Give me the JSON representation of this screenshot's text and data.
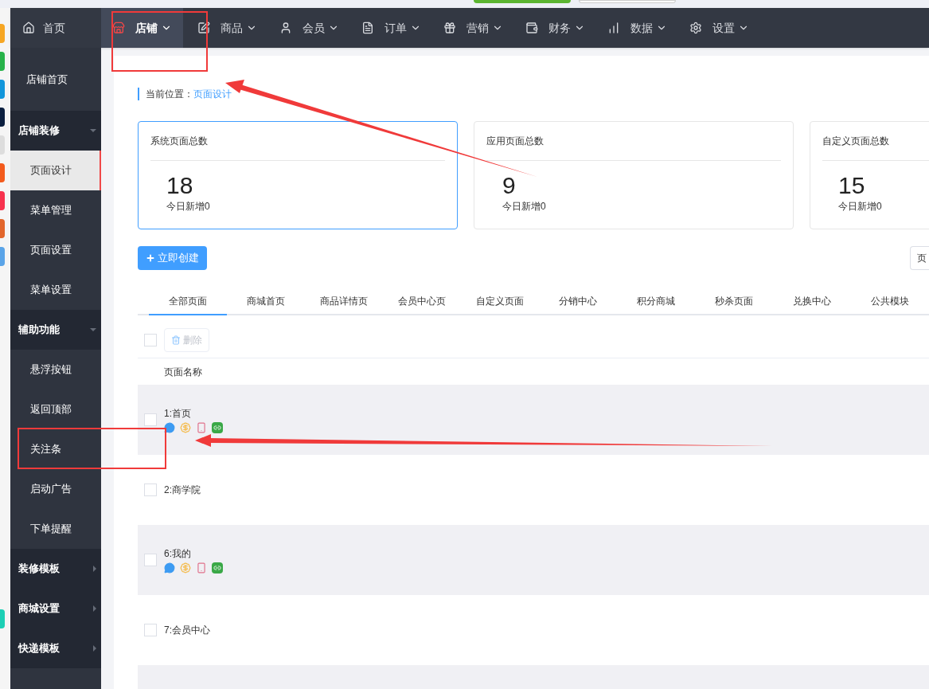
{
  "nav": {
    "home": "首页",
    "items": [
      {
        "label": "店铺",
        "selected": true
      },
      {
        "label": "商品",
        "selected": false
      },
      {
        "label": "会员",
        "selected": false
      },
      {
        "label": "订单",
        "selected": false
      },
      {
        "label": "营销",
        "selected": false
      },
      {
        "label": "财务",
        "selected": false
      },
      {
        "label": "数据",
        "selected": false
      },
      {
        "label": "设置",
        "selected": false
      }
    ]
  },
  "sidebar": {
    "items": [
      {
        "kind": "link",
        "label": "店铺首页",
        "selected": false
      },
      {
        "kind": "section",
        "label": "店铺装修",
        "expanded": true,
        "children": [
          {
            "kind": "link",
            "label": "页面设计",
            "selected": true
          },
          {
            "kind": "link",
            "label": "菜单管理",
            "selected": false
          },
          {
            "kind": "link",
            "label": "页面设置",
            "selected": false
          },
          {
            "kind": "link",
            "label": "菜单设置",
            "selected": false
          }
        ]
      },
      {
        "kind": "section",
        "label": "辅助功能",
        "expanded": true,
        "children": [
          {
            "kind": "link",
            "label": "悬浮按钮",
            "selected": false
          },
          {
            "kind": "link",
            "label": "返回顶部",
            "selected": false
          },
          {
            "kind": "link",
            "label": "关注条",
            "selected": false
          },
          {
            "kind": "link",
            "label": "启动广告",
            "selected": false
          },
          {
            "kind": "link",
            "label": "下单提醒",
            "selected": false
          }
        ]
      },
      {
        "kind": "section",
        "label": "装修模板",
        "expanded": false
      },
      {
        "kind": "section",
        "label": "商城设置",
        "expanded": false
      },
      {
        "kind": "section",
        "label": "快递模板",
        "expanded": false
      }
    ]
  },
  "breadcrumb": {
    "label": "当前位置：",
    "current": "页面设计"
  },
  "stats": [
    {
      "title": "系统页面总数",
      "value": "18",
      "sub": "今日新增0",
      "selected": true
    },
    {
      "title": "应用页面总数",
      "value": "9",
      "sub": "今日新增0",
      "selected": false
    },
    {
      "title": "自定义页面总数",
      "value": "15",
      "sub": "今日新增0",
      "selected": false
    }
  ],
  "create_button": "立即创建",
  "filter_fragment": "页",
  "tabs": [
    {
      "label": "全部页面",
      "selected": true
    },
    {
      "label": "商城首页",
      "selected": false
    },
    {
      "label": "商品详情页",
      "selected": false
    },
    {
      "label": "会员中心页",
      "selected": false
    },
    {
      "label": "自定义页面",
      "selected": false
    },
    {
      "label": "分销中心",
      "selected": false
    },
    {
      "label": "积分商城",
      "selected": false
    },
    {
      "label": "秒杀页面",
      "selected": false
    },
    {
      "label": "兑换中心",
      "selected": false
    },
    {
      "label": "公共模块",
      "selected": false
    }
  ],
  "toolbar": {
    "checked": false,
    "delete": {
      "label": "删除",
      "disabled": true
    }
  },
  "table": {
    "columns": [
      "页面名称"
    ],
    "rows": [
      {
        "name": "1:首页",
        "checked": false,
        "platform_icons": true
      },
      {
        "name": "2:商学院",
        "checked": false,
        "platform_icons": false
      },
      {
        "name": "6:我的",
        "checked": false,
        "platform_icons": true
      },
      {
        "name": "7:会员中心",
        "checked": false,
        "platform_icons": false
      }
    ]
  }
}
